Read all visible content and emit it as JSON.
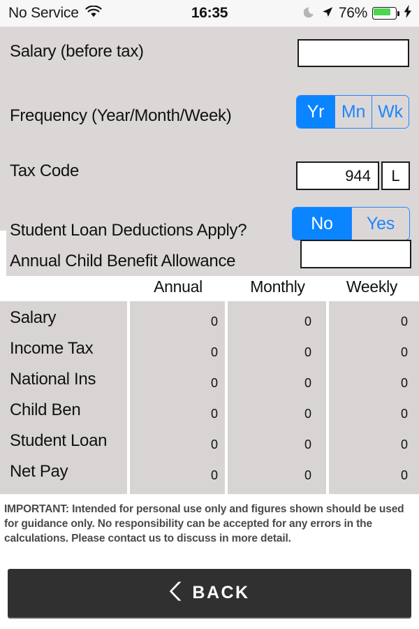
{
  "status_bar": {
    "carrier": "No Service",
    "wifi_icon": "wifi-icon",
    "time": "16:35",
    "moon_icon": "moon-icon",
    "location_icon": "location-arrow-icon",
    "battery_percent": "76%",
    "battery_level": 76,
    "battery_icon": "battery-icon",
    "charging_icon": "lightning-bolt-icon",
    "battery_color": "#4cd654"
  },
  "form": {
    "salary": {
      "label": "Salary (before tax)",
      "value": "",
      "placeholder": ""
    },
    "frequency": {
      "label": "Frequency (Year/Month/Week)",
      "options": [
        "Yr",
        "Mn",
        "Wk"
      ],
      "selected": "Yr"
    },
    "tax_code": {
      "label": "Tax Code",
      "number": "944",
      "letter": "L"
    },
    "student_loan": {
      "label": "Student Loan Deductions Apply?",
      "options": [
        "No",
        "Yes"
      ],
      "selected": "No"
    },
    "child_benefit": {
      "label": "Annual Child Benefit Allowance",
      "value": "",
      "placeholder": ""
    },
    "accent_color": "#0a84ff",
    "background_color": "#dcd7d7"
  },
  "results": {
    "columns": [
      "Annual",
      "Monthly",
      "Weekly"
    ],
    "rows": [
      {
        "label": "Salary",
        "annual": "0",
        "monthly": "0",
        "weekly": "0"
      },
      {
        "label": "Income Tax",
        "annual": "0",
        "monthly": "0",
        "weekly": "0"
      },
      {
        "label": "National Ins",
        "annual": "0",
        "monthly": "0",
        "weekly": "0"
      },
      {
        "label": "Child Ben",
        "annual": "0",
        "monthly": "0",
        "weekly": "0"
      },
      {
        "label": "Student Loan",
        "annual": "0",
        "monthly": "0",
        "weekly": "0"
      },
      {
        "label": "Net Pay",
        "annual": "0",
        "monthly": "0",
        "weekly": "0"
      }
    ]
  },
  "disclaimer": {
    "text": "IMPORTANT: Intended for personal use only and figures shown should be used for guidance only. No responsibility can be accepted for any errors in the calculations. Please contact us to discuss in more detail."
  },
  "footer": {
    "back_label": "BACK",
    "back_icon": "chevron-left-icon"
  }
}
